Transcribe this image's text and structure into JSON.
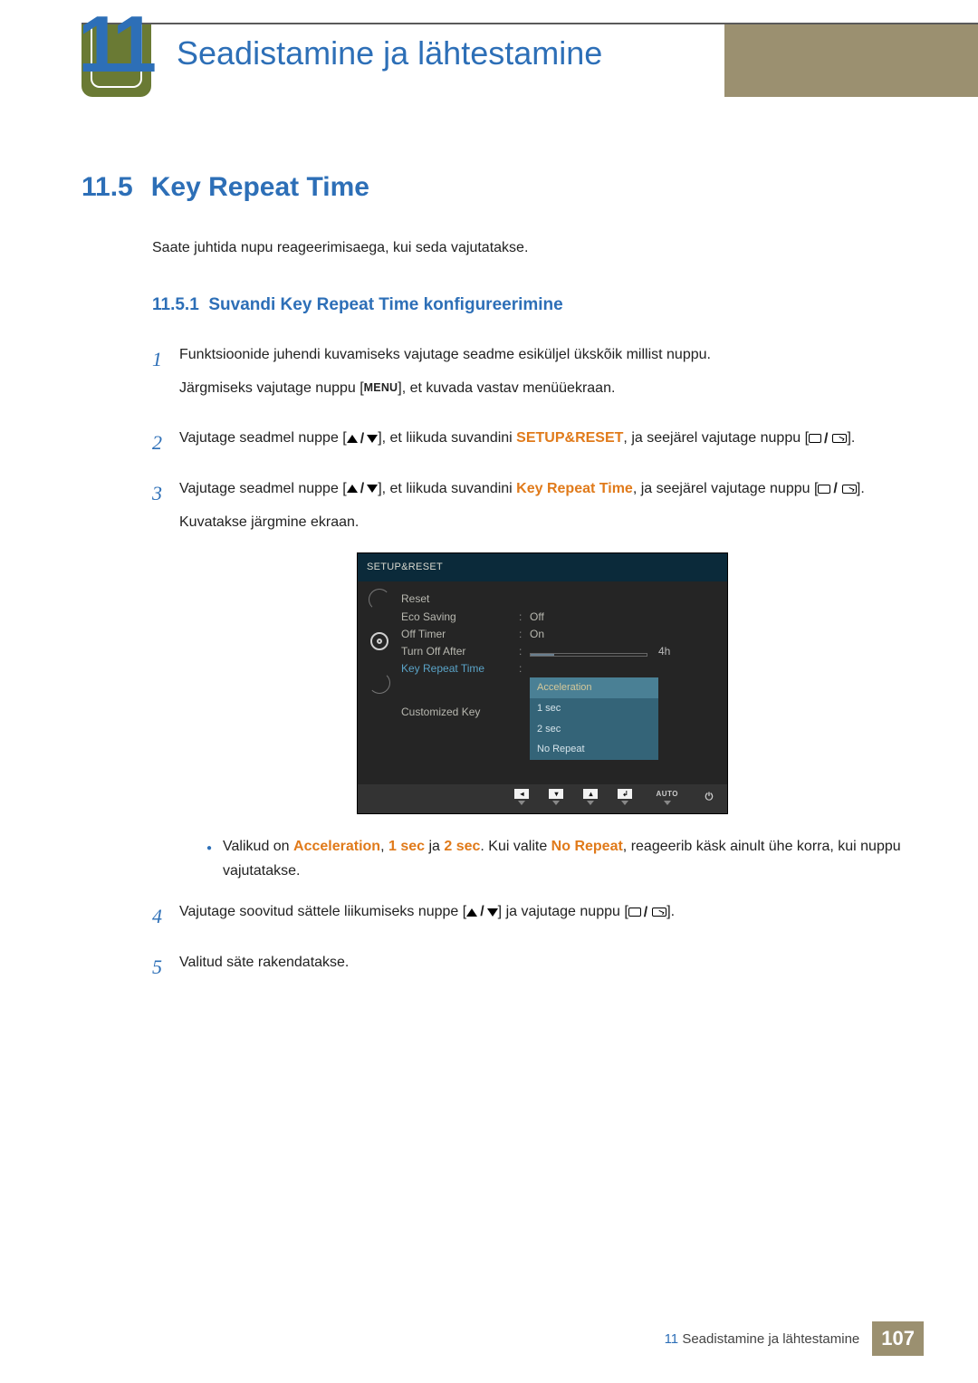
{
  "chapter": {
    "number": "11",
    "title": "Seadistamine ja lähtestamine"
  },
  "section": {
    "number": "11.5",
    "title": "Key Repeat Time",
    "intro": "Saate juhtida nupu reageerimisaega, kui seda vajutatakse."
  },
  "subsection": {
    "number": "11.5.1",
    "title": "Suvandi Key Repeat Time konfigureerimine"
  },
  "steps": {
    "s1": {
      "num": "1",
      "a": "Funktsioonide juhendi kuvamiseks vajutage seadme esiküljel ükskõik millist nuppu.",
      "b_pre": "Järgmiseks vajutage nuppu [",
      "b_menu": "MENU",
      "b_post": "], et kuvada vastav menüüekraan."
    },
    "s2": {
      "num": "2",
      "a_pre": "Vajutage seadmel nuppe [",
      "a_post": "], et liikuda suvandini ",
      "a_target": "SETUP&RESET",
      "a_tail": ", ja seejärel vajutage nuppu [",
      "a_end": "]."
    },
    "s3": {
      "num": "3",
      "a_pre": "Vajutage seadmel nuppe [",
      "a_post": "], et liikuda suvandini ",
      "a_target": "Key Repeat Time",
      "a_tail": ", ja seejärel vajutage nuppu [",
      "a_end": "].",
      "b": "Kuvatakse järgmine ekraan."
    },
    "note": {
      "pre": "Valikud on ",
      "o1": "Acceleration",
      "c1": ", ",
      "o2": "1 sec",
      "c2": " ja ",
      "o3": "2 sec",
      "c3": ". Kui valite ",
      "o4": "No Repeat",
      "post": ", reageerib käsk ainult ühe korra, kui nuppu vajutatakse."
    },
    "s4": {
      "num": "4",
      "a_pre": "Vajutage soovitud sättele liikumiseks nuppe [",
      "a_mid": "] ja vajutage nuppu [",
      "a_end": "]."
    },
    "s5": {
      "num": "5",
      "a": "Valitud säte rakendatakse."
    }
  },
  "osd": {
    "header": "SETUP&RESET",
    "items": {
      "reset": "Reset",
      "eco": "Eco Saving",
      "eco_val": "Off",
      "off_timer": "Off Timer",
      "off_timer_val": "On",
      "turn_off_after": "Turn Off After",
      "turn_off_after_val": "4h",
      "key_repeat": "Key Repeat Time",
      "customized": "Customized Key"
    },
    "dropdown": [
      "Acceleration",
      "1 sec",
      "2 sec",
      "No Repeat"
    ],
    "nav_auto": "AUTO"
  },
  "footer": {
    "chapter_num": "11",
    "chapter_title": "Seadistamine ja lähtestamine",
    "page": "107"
  }
}
